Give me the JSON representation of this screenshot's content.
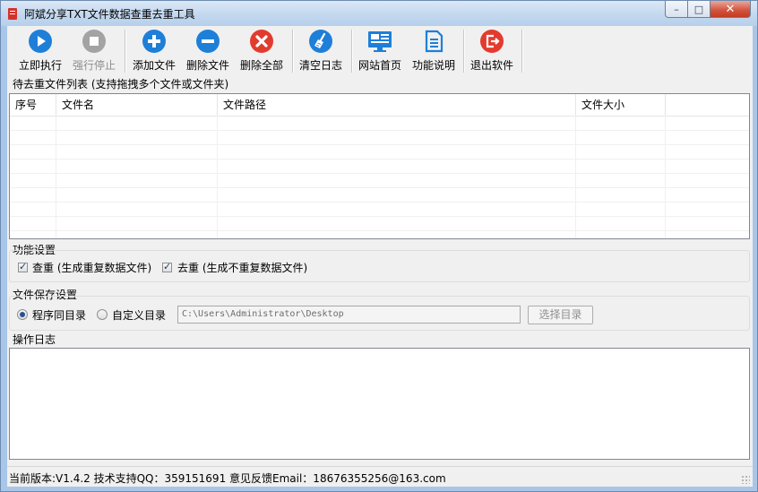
{
  "window": {
    "title": "阿斌分享TXT文件数据查重去重工具",
    "controls": {
      "minimize": "–",
      "maximize": "□",
      "close": "✕"
    }
  },
  "toolbar": {
    "buttons": [
      {
        "label": "立即执行",
        "icon": "play-icon",
        "color": "#1e7fd8",
        "enabled": true
      },
      {
        "label": "强行停止",
        "icon": "stop-icon",
        "color": "#a3a3a3",
        "enabled": false
      },
      {
        "label": "添加文件",
        "icon": "plus-icon",
        "color": "#1e7fd8",
        "enabled": true
      },
      {
        "label": "删除文件",
        "icon": "minus-icon",
        "color": "#1e7fd8",
        "enabled": true
      },
      {
        "label": "删除全部",
        "icon": "x-circle-icon",
        "color": "#e23b2e",
        "enabled": true
      },
      {
        "label": "清空日志",
        "icon": "broom-icon",
        "color": "#1e7fd8",
        "enabled": true
      },
      {
        "label": "网站首页",
        "icon": "monitor-icon",
        "color": "#1e7fd8",
        "enabled": true
      },
      {
        "label": "功能说明",
        "icon": "document-icon",
        "color": "#1e7fd8",
        "enabled": true
      },
      {
        "label": "退出软件",
        "icon": "exit-icon",
        "color": "#e23b2e",
        "enabled": true
      }
    ]
  },
  "file_list": {
    "label": "待去重文件列表 (支持拖拽多个文件或文件夹)",
    "columns": [
      "序号",
      "文件名",
      "文件路径",
      "文件大小",
      ""
    ],
    "rows": []
  },
  "function_settings": {
    "label": "功能设置",
    "options": [
      {
        "label": "查重 (生成重复数据文件)",
        "checked": true
      },
      {
        "label": "去重 (生成不重复数据文件)",
        "checked": true
      }
    ]
  },
  "save_settings": {
    "label": "文件保存设置",
    "options": [
      {
        "label": "程序同目录",
        "selected": true
      },
      {
        "label": "自定义目录",
        "selected": false
      }
    ],
    "path_value": "C:\\Users\\Administrator\\Desktop",
    "choose_button": "选择目录"
  },
  "log": {
    "label": "操作日志",
    "content": ""
  },
  "status_bar": {
    "text": "当前版本:V1.4.2  技术支持QQ：359151691  意见反馈Email：18676355256@163.com"
  }
}
